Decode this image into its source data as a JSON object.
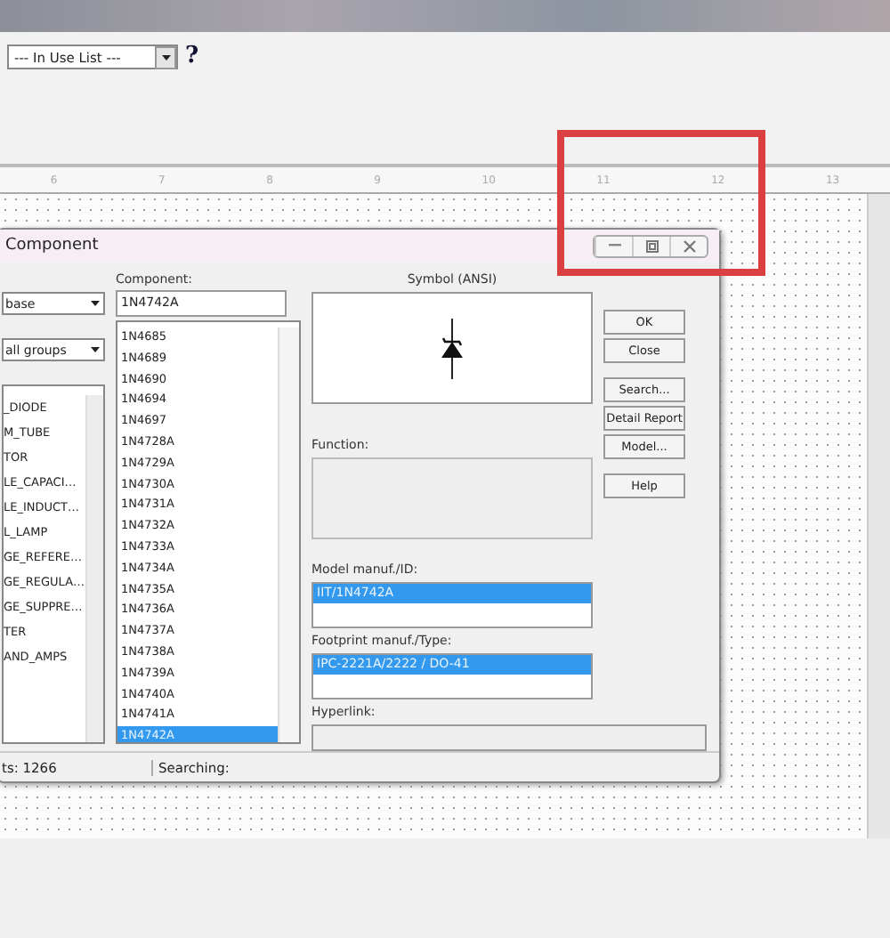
{
  "toolbar": {
    "dropdown": {
      "value": "--- In Use List ---"
    },
    "help": "?"
  },
  "ruler": {
    "labels": [
      "6",
      "7",
      "8",
      "9",
      "10",
      "11",
      "12",
      "13"
    ]
  },
  "dialog": {
    "title": "Component",
    "database": {
      "value": "base"
    },
    "group": {
      "value": "all groups"
    },
    "families": [
      {
        "label": "_DIODE",
        "selected": false
      },
      {
        "label": "M_TUBE",
        "selected": false
      },
      {
        "label": "TOR",
        "selected": false
      },
      {
        "label": "LE_CAPACI…",
        "selected": false
      },
      {
        "label": "LE_INDUCT…",
        "selected": false
      },
      {
        "label": "L_LAMP",
        "selected": false
      },
      {
        "label": "GE_REFERE…",
        "selected": false
      },
      {
        "label": "GE_REGULA…",
        "selected": false
      },
      {
        "label": "GE_SUPPRE…",
        "selected": false
      },
      {
        "label": "TER",
        "selected": false
      },
      {
        "label": "AND_AMPS",
        "selected": false
      }
    ],
    "component_label": "Component:",
    "component_value": "1N4742A",
    "components": [
      {
        "label": "1N4685",
        "selected": false
      },
      {
        "label": "1N4689",
        "selected": false
      },
      {
        "label": "1N4690",
        "selected": false
      },
      {
        "label": "1N4694",
        "selected": false
      },
      {
        "label": "1N4697",
        "selected": false
      },
      {
        "label": "1N4728A",
        "selected": false
      },
      {
        "label": "1N4729A",
        "selected": false
      },
      {
        "label": "1N4730A",
        "selected": false
      },
      {
        "label": "1N4731A",
        "selected": false
      },
      {
        "label": "1N4732A",
        "selected": false
      },
      {
        "label": "1N4733A",
        "selected": false
      },
      {
        "label": "1N4734A",
        "selected": false
      },
      {
        "label": "1N4735A",
        "selected": false
      },
      {
        "label": "1N4736A",
        "selected": false
      },
      {
        "label": "1N4737A",
        "selected": false
      },
      {
        "label": "1N4738A",
        "selected": false
      },
      {
        "label": "1N4739A",
        "selected": false
      },
      {
        "label": "1N4740A",
        "selected": false
      },
      {
        "label": "1N4741A",
        "selected": false
      },
      {
        "label": "1N4742A",
        "selected": true
      }
    ],
    "symbol_label": "Symbol (ANSI)",
    "function_label": "Function:",
    "model_label": "Model manuf./ID:",
    "models": [
      {
        "label": "IIT/1N4742A",
        "selected": true
      }
    ],
    "footprint_label": "Footprint manuf./Type:",
    "footprints": [
      {
        "label": "IPC-2221A/2222 / DO-41",
        "selected": true
      }
    ],
    "hyperlink_label": "Hyperlink:",
    "buttons": [
      "OK",
      "Close",
      "Search...",
      "Detail Report",
      "Model...",
      "Help"
    ],
    "status": [
      "ts: 1266",
      "Searching:"
    ]
  }
}
